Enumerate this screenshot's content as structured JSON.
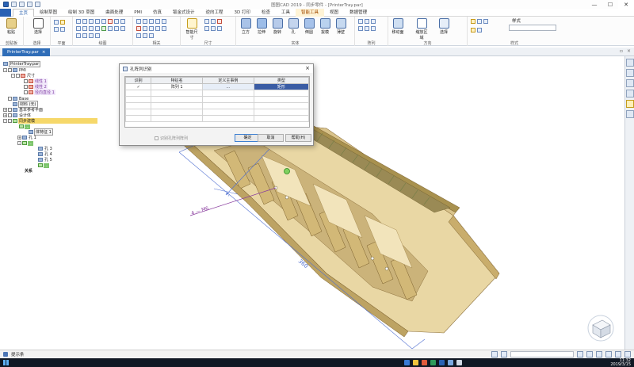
{
  "window": {
    "title": "图图CAD 2019 - 同步零件 - [PrinterTray.par]"
  },
  "tabs": [
    "主页",
    "绘制草图",
    "绘制 3D 草图",
    "曲面处理",
    "PMI",
    "仿真",
    "钣金式设计",
    "逆向工程",
    "3D 打印",
    "检查",
    "工具",
    "智能工具",
    "视图",
    "数据管理"
  ],
  "active_tab": "主页",
  "ribbon": {
    "groups": [
      {
        "label": "剪贴板",
        "buttons": [
          "粘贴"
        ]
      },
      {
        "label": "选择",
        "buttons": [
          "选择"
        ]
      },
      {
        "label": "平面",
        "buttons": []
      },
      {
        "label": "绘图",
        "buttons": []
      },
      {
        "label": "相关",
        "buttons": []
      },
      {
        "label": "尺寸",
        "buttons": [
          "智能尺寸"
        ]
      },
      {
        "label": "实体",
        "buttons": [
          "立方",
          "拉伸",
          "旋转",
          "孔",
          "倒圆",
          "拔模",
          "薄壁"
        ]
      },
      {
        "label": "阵列",
        "buttons": []
      },
      {
        "label": "方向",
        "buttons": [
          "移动面",
          "缩放区域",
          "选择"
        ]
      },
      {
        "label": "样式",
        "buttons": []
      }
    ],
    "style_label": "样式"
  },
  "doc_tab": {
    "label": "PrinterTray.par",
    "close": "×"
  },
  "tree": {
    "items": [
      {
        "label": "PrinterTray.par"
      },
      {
        "label": "PMI"
      },
      {
        "label": "尺寸"
      },
      {
        "label": "线性 1"
      },
      {
        "label": "线性 2"
      },
      {
        "label": "径向直径 1"
      },
      {
        "label": "Base"
      },
      {
        "label": "材料 (无)"
      },
      {
        "label": "基本参考平面"
      },
      {
        "label": "设计体"
      },
      {
        "label": "同步建模"
      },
      {
        "label": "..."
      },
      {
        "label": "体特征 1"
      },
      {
        "label": "孔 1"
      },
      {
        "label": "..."
      },
      {
        "label": "孔 3"
      },
      {
        "label": "孔 4"
      },
      {
        "label": "孔 5"
      },
      {
        "label": "..."
      },
      {
        "label": "关系"
      }
    ]
  },
  "dialog": {
    "title": "孔阵列识别",
    "close": "×",
    "columns": [
      "识别",
      "特征名",
      "定义主事例",
      "类型"
    ],
    "rows": [
      {
        "recognize": "✓",
        "feature": "阵列 1",
        "def": "…",
        "type": "矩形"
      }
    ],
    "checkbox_label": "识别孔阵列阵列",
    "ok": "确定",
    "cancel": "取消",
    "help": "帮助(H)"
  },
  "model": {
    "dim_upper": "3",
    "dim_lower": "4 — M6",
    "dim_length": "360"
  },
  "status": {
    "hint": "提示条"
  },
  "taskbar": {
    "time": "11:32",
    "date": "2019/3/15"
  },
  "colors": {
    "accent": "#2a62b4",
    "model_face": "#e8d7a6",
    "model_edge": "#8a6e3b",
    "dimension": "#4f6fd1",
    "selected_row": "#3a5ca4"
  }
}
